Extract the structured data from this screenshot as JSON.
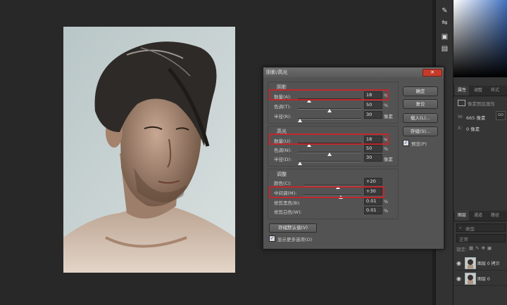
{
  "dialog": {
    "title": "阴影/高光",
    "close_symbol": "✕",
    "shadows": {
      "title": "阴影",
      "amount": {
        "label": "数量(A):",
        "value": "18",
        "unit": "%",
        "level": 0.18
      },
      "tone": {
        "label": "色调(T):",
        "value": "50",
        "unit": "%",
        "level": 0.5
      },
      "radius": {
        "label": "半径(R):",
        "value": "30",
        "unit": "像素",
        "level": 0.03
      }
    },
    "highlights": {
      "title": "高光",
      "amount": {
        "label": "数量(U):",
        "value": "18",
        "unit": "%",
        "level": 0.18
      },
      "tone": {
        "label": "色调(N):",
        "value": "50",
        "unit": "%",
        "level": 0.5
      },
      "radius": {
        "label": "半径(D):",
        "value": "30",
        "unit": "像素",
        "level": 0.03
      }
    },
    "adjustments": {
      "title": "调整",
      "color": {
        "label": "颜色(C):",
        "value": "+20",
        "unit": "",
        "level": 0.6
      },
      "midtone": {
        "label": "中间调(M):",
        "value": "+30",
        "unit": "",
        "level": 0.65
      },
      "black_clip": {
        "label": "修剪黑色(B):",
        "value": "0.01",
        "unit": "%",
        "level": 0.0
      },
      "white_clip": {
        "label": "修剪白色(W):",
        "value": "0.01",
        "unit": "%",
        "level": 0.0
      }
    },
    "buttons": {
      "ok": "确定",
      "reset": "复位",
      "load": "载入(L)...",
      "save": "存储(S)..."
    },
    "preview": {
      "label": "预览(P)",
      "checked": true
    },
    "save_default": "存储默认值(V)",
    "more_options": {
      "label": "显示更多选项(O)",
      "checked": true
    }
  },
  "right_panel": {
    "props_tabs": [
      "属性",
      "调整",
      "样式"
    ],
    "doc_props_label": "像素图层属性",
    "w_label": "W:",
    "w_value": "665 像素",
    "x_label": "X:",
    "x_value": "0 像素",
    "link_symbol": "GO",
    "layers_tabs": [
      "图层",
      "通道",
      "路径"
    ],
    "kind_filter": "类型",
    "blend_mode": "正常",
    "lock_label": "锁定:",
    "layers": [
      {
        "name": "图层 0 拷贝"
      },
      {
        "name": "图层 0"
      }
    ]
  },
  "toolbar_icons": [
    "brush-icon",
    "adjust-icon",
    "save-icon",
    "export-icon"
  ],
  "colors": {
    "highlight": "#c1272d",
    "close": "#c53b2b"
  }
}
